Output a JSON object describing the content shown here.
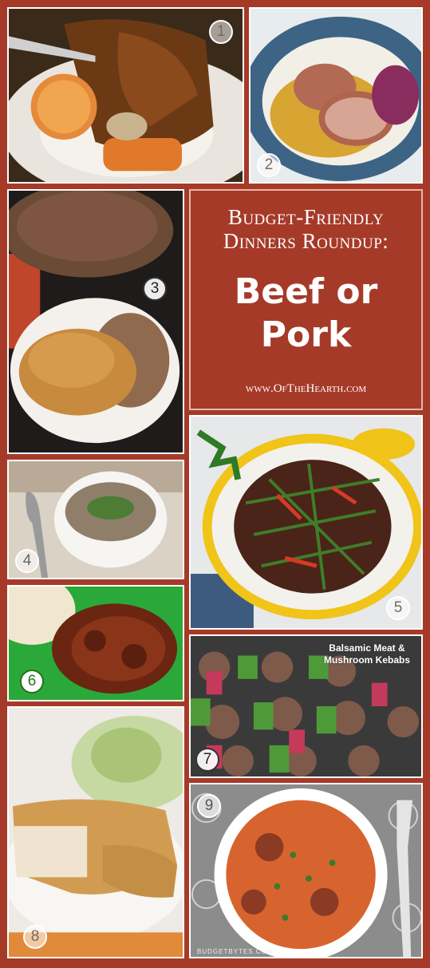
{
  "title": {
    "line1": "Budget-Friendly",
    "line2": "Dinners Roundup:",
    "main_line1": "Beef or",
    "main_line2": "Pork",
    "website": "www.OfTheHearth.com"
  },
  "tiles": [
    {
      "number": "1",
      "description": "pot-roast-with-potatoes-carrots-rice"
    },
    {
      "number": "2",
      "description": "pork-tenderloin-with-apples-cabbage"
    },
    {
      "number": "3",
      "description": "pulled-pork-sandwich"
    },
    {
      "number": "4",
      "description": "beef-barley-stew"
    },
    {
      "number": "5",
      "description": "beef-green-bean-pepper-stir-fry"
    },
    {
      "number": "6",
      "description": "beef-tips-in-gravy"
    },
    {
      "number": "7",
      "description": "balsamic-meat-mushroom-kebabs",
      "caption_line1": "Balsamic Meat &",
      "caption_line2": "Mushroom Kebabs"
    },
    {
      "number": "8",
      "description": "breaded-pork-chop"
    },
    {
      "number": "9",
      "description": "sausage-rice-skillet",
      "watermark": "BUDGETBYTES.COM"
    }
  ]
}
